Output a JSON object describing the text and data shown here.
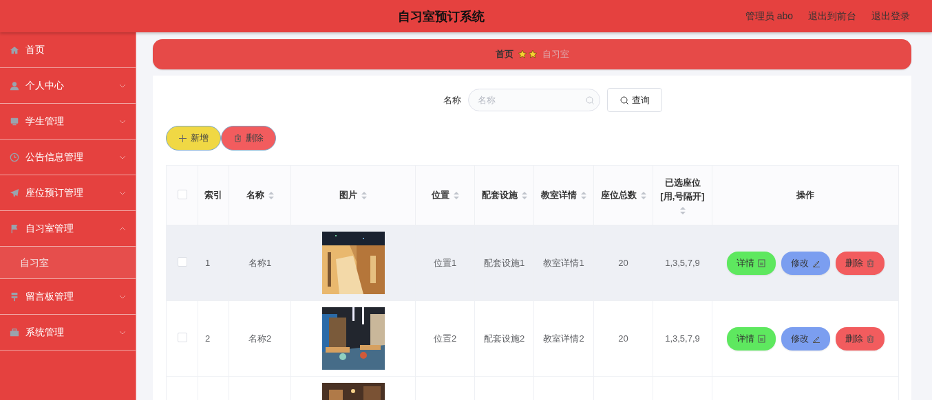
{
  "header": {
    "title": "自习室预订系统",
    "links": [
      "管理员 abo",
      "退出到前台",
      "退出登录"
    ]
  },
  "sidebar": {
    "items": [
      {
        "label": "首页",
        "has_children": false,
        "selected": false
      },
      {
        "label": "个人中心",
        "has_children": true,
        "expanded": false,
        "selected": false
      },
      {
        "label": "学生管理",
        "has_children": true,
        "expanded": false,
        "selected": false
      },
      {
        "label": "公告信息管理",
        "has_children": true,
        "expanded": false,
        "selected": false
      },
      {
        "label": "座位预订管理",
        "has_children": true,
        "expanded": false,
        "selected": false
      },
      {
        "label": "自习室管理",
        "has_children": true,
        "expanded": true,
        "selected": false,
        "children": [
          {
            "label": "自习室",
            "selected": true
          }
        ]
      },
      {
        "label": "留言板管理",
        "has_children": true,
        "expanded": false,
        "selected": false
      },
      {
        "label": "系统管理",
        "has_children": true,
        "expanded": false,
        "selected": false
      }
    ]
  },
  "breadcrumb": {
    "items": [
      "首页",
      "自习室"
    ]
  },
  "search": {
    "label": "名称",
    "placeholder": "名称",
    "button": "查询"
  },
  "toolbar": [
    {
      "label": "新增",
      "kind": "add"
    },
    {
      "label": "删除",
      "kind": "delete"
    }
  ],
  "table": {
    "select_all": {
      "checked": false
    },
    "columns": [
      {
        "label": "索引",
        "sortable": false
      },
      {
        "label": "名称",
        "sortable": true
      },
      {
        "label": "图片",
        "sortable": true
      },
      {
        "label": "位置",
        "sortable": true
      },
      {
        "label": "配套设施",
        "sortable": true
      },
      {
        "label": "教室详情",
        "sortable": true
      },
      {
        "label": "座位总数",
        "sortable": true
      },
      {
        "label": "已选座位[用,号隔开]",
        "sortable": true
      },
      {
        "label": "操作",
        "sortable": false
      }
    ],
    "rows": [
      {
        "checked": false,
        "hovered": true,
        "index": "1",
        "name": "名称1",
        "image": {
          "kind": "picture"
        },
        "location": "位置1",
        "facilities": "配套设施1",
        "details": "教室详情1",
        "seats": "20",
        "selected_seats": "1,3,5,7,9",
        "actions": [
          {
            "label": "详情",
            "kind": "detail"
          },
          {
            "label": "修改",
            "kind": "edit"
          },
          {
            "label": "删除",
            "kind": "delete"
          }
        ]
      },
      {
        "checked": false,
        "hovered": false,
        "index": "2",
        "name": "名称2",
        "image": {
          "kind": "picture"
        },
        "location": "位置2",
        "facilities": "配套设施2",
        "details": "教室详情2",
        "seats": "20",
        "selected_seats": "1,3,5,7,9",
        "actions": [
          {
            "label": "详情",
            "kind": "detail"
          },
          {
            "label": "修改",
            "kind": "edit"
          },
          {
            "label": "删除",
            "kind": "delete"
          }
        ]
      },
      {
        "image": {
          "kind": "picture"
        }
      }
    ]
  }
}
